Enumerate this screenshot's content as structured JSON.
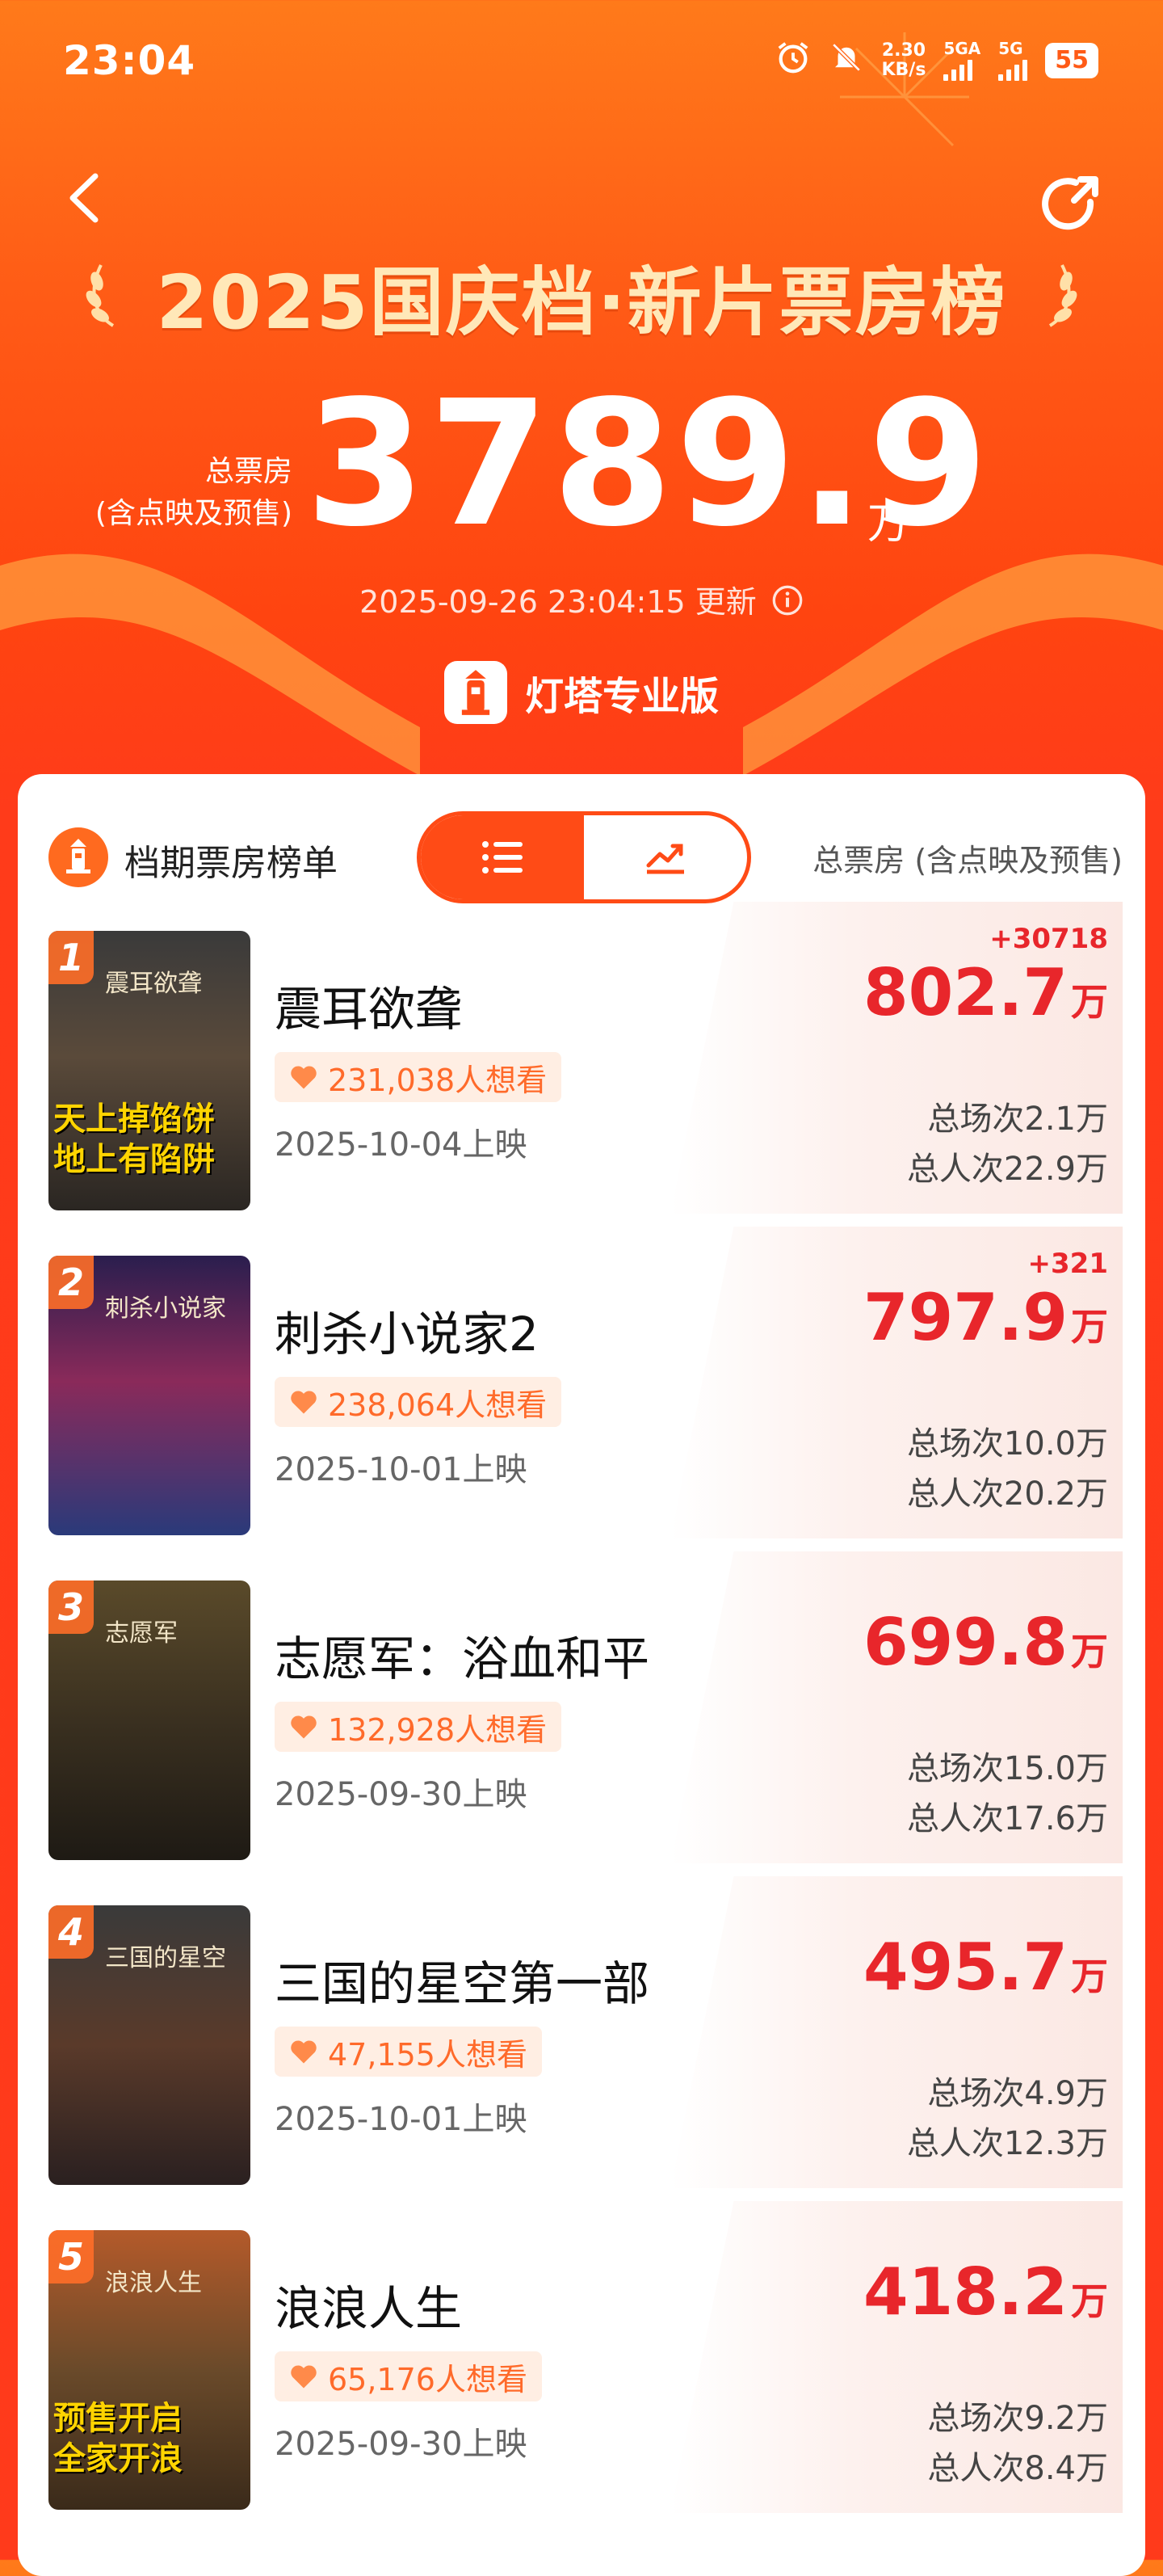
{
  "status_bar": {
    "time": "23:04",
    "speed_value": "2.30",
    "speed_unit": "KB/s",
    "sim1_label": "5GA",
    "sim2_label": "5G",
    "battery": "55",
    "icons": [
      "alarm-icon",
      "mute-bell-icon"
    ]
  },
  "header": {
    "title": "2025国庆档·新片票房榜",
    "total_label_line1": "总票房",
    "total_label_line2": "(含点映及预售)",
    "total_value": "3789.9",
    "total_unit": "万",
    "updated_text": "2025-09-26 23:04:15 更新",
    "info_icon": "info-icon",
    "brand": "灯塔专业版"
  },
  "ranking": {
    "title": "档期票房榜单",
    "toggle": [
      {
        "icon": "list-icon",
        "active": true
      },
      {
        "icon": "trend-chart-icon",
        "active": false
      }
    ],
    "column_label": "总票房 (含点映及预售)",
    "movies": [
      {
        "rank": "1",
        "name": "震耳欲聋",
        "want": "231,038人想看",
        "release": "2025-10-04上映",
        "delta": "+30718",
        "box_office": "802.7",
        "unit": "万",
        "shows": "总场次2.1万",
        "viewers": "总人次22.9万",
        "poster_text1": "天上掉馅饼",
        "poster_text2": "地上有陷阱",
        "poster_title": "震耳欲聋"
      },
      {
        "rank": "2",
        "name": "刺杀小说家2",
        "want": "238,064人想看",
        "release": "2025-10-01上映",
        "delta": "+321",
        "box_office": "797.9",
        "unit": "万",
        "shows": "总场次10.0万",
        "viewers": "总人次20.2万",
        "poster_text1": "",
        "poster_text2": "",
        "poster_title": "刺杀小说家"
      },
      {
        "rank": "3",
        "name": "志愿军：浴血和平",
        "want": "132,928人想看",
        "release": "2025-09-30上映",
        "delta": "",
        "box_office": "699.8",
        "unit": "万",
        "shows": "总场次15.0万",
        "viewers": "总人次17.6万",
        "poster_text1": "",
        "poster_text2": "",
        "poster_title": "志愿军"
      },
      {
        "rank": "4",
        "name": "三国的星空第一部",
        "want": "47,155人想看",
        "release": "2025-10-01上映",
        "delta": "",
        "box_office": "495.7",
        "unit": "万",
        "shows": "总场次4.9万",
        "viewers": "总人次12.3万",
        "poster_text1": "",
        "poster_text2": "",
        "poster_title": "三国的星空"
      },
      {
        "rank": "5",
        "name": "浪浪人生",
        "want": "65,176人想看",
        "release": "2025-09-30上映",
        "delta": "",
        "box_office": "418.2",
        "unit": "万",
        "shows": "总场次9.2万",
        "viewers": "总人次8.4万",
        "poster_text1": "预售开启",
        "poster_text2": "全家开浪",
        "poster_title": "浪浪人生"
      }
    ]
  },
  "colors": {
    "accent": "#ff4b16",
    "box_office_red": "#e8262b",
    "title_gold": "#ffe8b8"
  }
}
